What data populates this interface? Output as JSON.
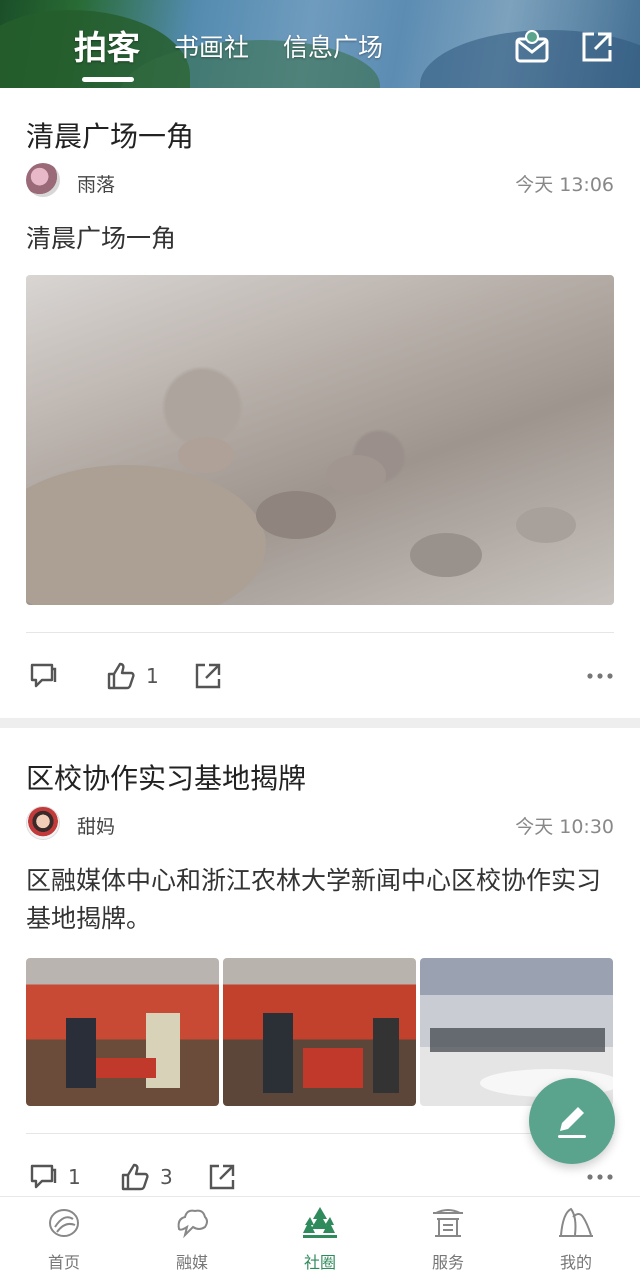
{
  "header": {
    "tabs": [
      {
        "label": "拍客",
        "active": true
      },
      {
        "label": "书画社",
        "active": false
      },
      {
        "label": "信息广场",
        "active": false
      }
    ],
    "icons": [
      "mail-icon",
      "share-icon"
    ]
  },
  "posts": [
    {
      "title": "清晨广场一角",
      "author": "雨落",
      "time": "今天 13:06",
      "text": "清晨广场一角",
      "images": 1,
      "actions": {
        "comments": "",
        "likes": "1"
      }
    },
    {
      "title": "区校协作实习基地揭牌",
      "author": "甜妈",
      "time": "今天 10:30",
      "text": "区融媒体中心和浙江农林大学新闻中心区校协作实习基地揭牌。",
      "images": 3,
      "actions": {
        "comments": "1",
        "likes": "3"
      }
    }
  ],
  "fab": {
    "icon": "edit-icon"
  },
  "bottom_nav": [
    {
      "label": "首页",
      "icon": "home-icon",
      "active": false
    },
    {
      "label": "融媒",
      "icon": "media-icon",
      "active": false
    },
    {
      "label": "社圈",
      "icon": "community-icon",
      "active": true
    },
    {
      "label": "服务",
      "icon": "service-icon",
      "active": false
    },
    {
      "label": "我的",
      "icon": "profile-icon",
      "active": false
    }
  ],
  "colors": {
    "accent": "#2f8a5c",
    "fab": "#5aa48e"
  }
}
